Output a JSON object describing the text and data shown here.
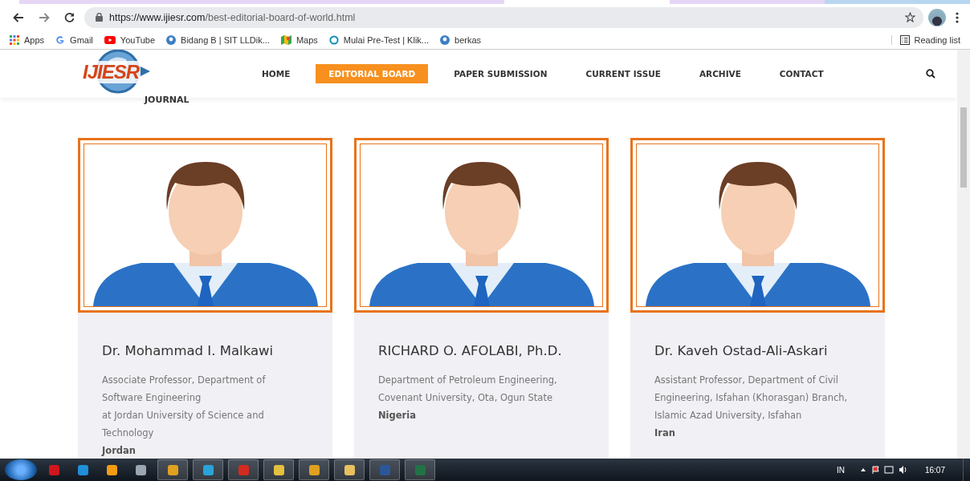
{
  "browser": {
    "url_host": "https://www.ijiesr.com",
    "url_path": "/best-editorial-board-of-world.html",
    "bookmarks": [
      {
        "label": "Apps",
        "kind": "apps"
      },
      {
        "label": "Gmail",
        "kind": "google"
      },
      {
        "label": "YouTube",
        "kind": "youtube"
      },
      {
        "label": "Bidang B | SIT LLDik...",
        "kind": "site"
      },
      {
        "label": "Maps",
        "kind": "maps"
      },
      {
        "label": "Mulai Pre-Test | Klik...",
        "kind": "ring"
      },
      {
        "label": "berkas",
        "kind": "site"
      }
    ],
    "reading_list": "Reading list"
  },
  "header": {
    "logo_text": "IJIESR",
    "tagline": "JOURNAL",
    "nav": [
      {
        "label": "HOME",
        "selected": false
      },
      {
        "label": "EDITORIAL BOARD",
        "selected": true
      },
      {
        "label": "PAPER SUBMISSION",
        "selected": false
      },
      {
        "label": "CURRENT ISSUE",
        "selected": false
      },
      {
        "label": "ARCHIVE",
        "selected": false
      },
      {
        "label": "CONTACT",
        "selected": false
      }
    ]
  },
  "members": [
    {
      "name": "Dr. Mohammad I. Malkawi",
      "description": [
        "Associate Professor, Department of Software Engineering",
        "at Jordan University of Science and Technology"
      ],
      "country": "Jordan"
    },
    {
      "name": "RICHARD O. AFOLABI, Ph.D.",
      "description": [
        "Department of Petroleum Engineering, Covenant University, Ota, Ogun State"
      ],
      "country": "Nigeria"
    },
    {
      "name": "Dr. Kaveh Ostad-Ali-Askari",
      "description": [
        "Assistant Professor, Department of Civil Engineering, Isfahan (Khorasgan) Branch, Islamic Azad University, Isfahan"
      ],
      "country": "Iran"
    }
  ],
  "taskbar": {
    "apps": [
      {
        "kind": "opera"
      },
      {
        "kind": "edge"
      },
      {
        "kind": "media"
      },
      {
        "kind": "calc"
      },
      {
        "kind": "chrome"
      },
      {
        "kind": "telegram"
      },
      {
        "kind": "pdf"
      },
      {
        "kind": "chat"
      },
      {
        "kind": "chrome"
      },
      {
        "kind": "folder"
      },
      {
        "kind": "word"
      },
      {
        "kind": "excel"
      }
    ],
    "language": "IN",
    "time": "16:07"
  }
}
